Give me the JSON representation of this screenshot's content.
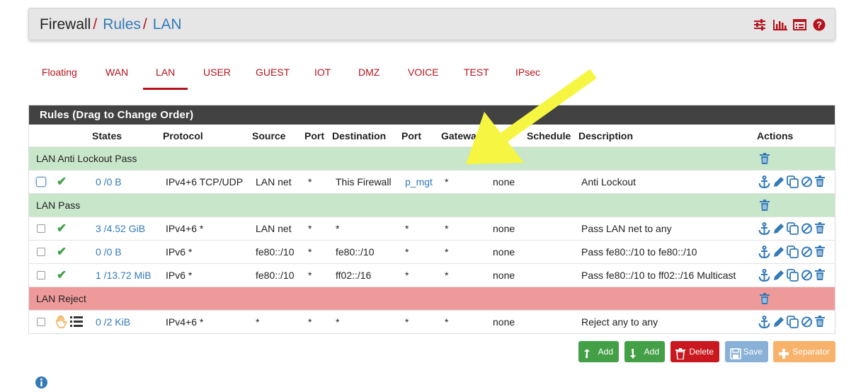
{
  "breadcrumb": {
    "root": "Firewall",
    "sep1": "/",
    "rules": "Rules",
    "sep2": "/",
    "current": "LAN"
  },
  "header_icons": [
    "sliders-icon",
    "bar-chart-icon",
    "list-icon",
    "help-icon"
  ],
  "tabs": [
    {
      "label": "Floating"
    },
    {
      "label": "WAN"
    },
    {
      "label": "LAN",
      "active": true
    },
    {
      "label": "USER"
    },
    {
      "label": "GUEST"
    },
    {
      "label": "IOT"
    },
    {
      "label": "DMZ"
    },
    {
      "label": "VOICE"
    },
    {
      "label": "TEST"
    },
    {
      "label": "IPsec"
    }
  ],
  "panel": {
    "title": "Rules (Drag to Change Order)",
    "columns": {
      "states": "States",
      "protocol": "Protocol",
      "source": "Source",
      "port": "Port",
      "destination": "Destination",
      "dport": "Port",
      "gateway": "Gateway",
      "schedule": "Schedule",
      "description": "Description",
      "actions": "Actions"
    },
    "separators": {
      "s1": "LAN Anti Lockout Pass",
      "s2": "LAN Pass",
      "s3": "LAN Reject"
    },
    "rows": [
      {
        "states": "0 /0 B",
        "protocol": "IPv4+6 TCP/UDP",
        "source": "LAN net",
        "port": "*",
        "destination": "This Firewall",
        "dport": "p_mgt",
        "gateway": "*",
        "queue": "none",
        "schedule": "",
        "description": "Anti Lockout"
      },
      {
        "states": "3 /4.52 GiB",
        "protocol": "IPv4+6 *",
        "source": "LAN net",
        "port": "*",
        "destination": "*",
        "dport": "*",
        "gateway": "*",
        "queue": "none",
        "schedule": "",
        "description": "Pass LAN net to any"
      },
      {
        "states": "0 /0 B",
        "protocol": "IPv6 *",
        "source": "fe80::/10",
        "port": "*",
        "destination": "fe80::/10",
        "dport": "*",
        "gateway": "*",
        "queue": "none",
        "schedule": "",
        "description": "Pass fe80::/10 to fe80::/10"
      },
      {
        "states": "1 /13.72 MiB",
        "protocol": "IPv6 *",
        "source": "fe80::/10",
        "port": "*",
        "destination": "ff02::/16",
        "dport": "*",
        "gateway": "*",
        "queue": "none",
        "schedule": "",
        "description": "Pass fe80::/10 to ff02::/16 Multicast"
      },
      {
        "states": "0 /2 KiB",
        "protocol": "IPv4+6 *",
        "source": "*",
        "port": "*",
        "destination": "*",
        "dport": "*",
        "gateway": "*",
        "queue": "none",
        "schedule": "",
        "description": "Reject any to any"
      }
    ]
  },
  "buttons": {
    "add_top": "Add",
    "add_bottom": "Add",
    "delete": "Delete",
    "save": "Save",
    "separator": "Separator"
  },
  "colors": {
    "brand_red": "#b5121b",
    "link_blue": "#337ab7",
    "pass_green": "#c8e6c9",
    "reject_red": "#ef9a9a",
    "arrow_yellow": "#f5f542"
  }
}
